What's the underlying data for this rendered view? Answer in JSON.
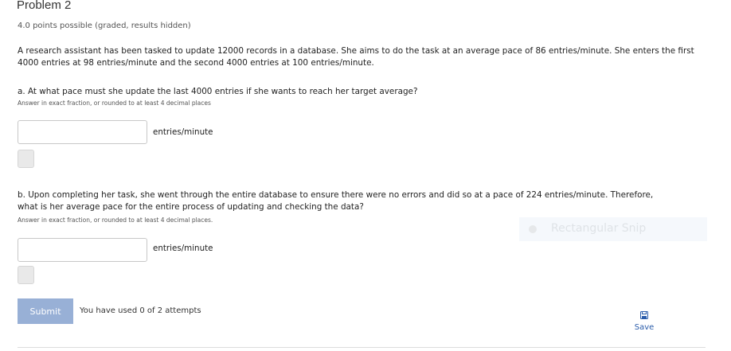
{
  "problem": {
    "title": "Problem 2",
    "points": "4.0 points possible (graded, results hidden)",
    "statement": "A research assistant has been tasked to update 12000 records in a database. She aims to do the task at an average pace of 86 entries/minute. She enters the first 4000 entries at 98 entries/minute and the second 4000 entries at 100 entries/minute."
  },
  "part_a": {
    "question": "a. At what pace must she update the last 4000 entries if she wants to reach her target average?",
    "hint": "Answer in exact fraction, or rounded to at least 4 decimal places",
    "value": "",
    "unit": "entries/minute"
  },
  "part_b": {
    "question": "b. Upon completing her task, she went through the entire database to ensure there were no errors and did so at a pace of 224 entries/minute. Therefore, what is her average pace for the entire process of updating and checking the data?",
    "hint": "Answer in exact fraction, or rounded to at least 4 decimal places.",
    "value": "",
    "unit": "entries/minute"
  },
  "footer": {
    "submit_label": "Submit",
    "attempts_text": "You have used 0 of 2 attempts",
    "save_label": "Save",
    "save_icon": "floppy-disk-icon"
  },
  "overlay": {
    "snip_label": "Rectangular Snip"
  },
  "colors": {
    "submit_bg": "#98b0d6",
    "save_link": "#2a5caa"
  }
}
